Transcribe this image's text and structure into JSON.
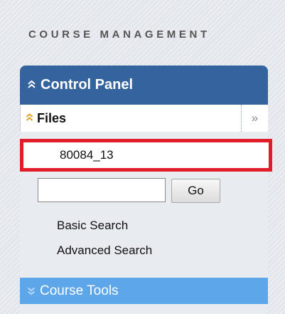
{
  "section": {
    "heading": "COURSE MANAGEMENT"
  },
  "control_panel": {
    "title": "Control Panel",
    "files": {
      "label": "Files",
      "expand_glyph": "»",
      "item": "80084_13"
    },
    "search": {
      "value": "",
      "go_label": "Go",
      "basic_label": "Basic Search",
      "advanced_label": "Advanced Search"
    }
  },
  "course_tools": {
    "label": "Course Tools"
  },
  "colors": {
    "panel_header": "#34639e",
    "course_tools": "#5da6ea",
    "highlight": "#e01e2a"
  },
  "icons": {
    "control_panel": "double-chevron-up-icon",
    "files": "double-chevron-up-icon",
    "expand": "double-chevron-right-icon",
    "course_tools": "double-chevron-down-icon"
  }
}
